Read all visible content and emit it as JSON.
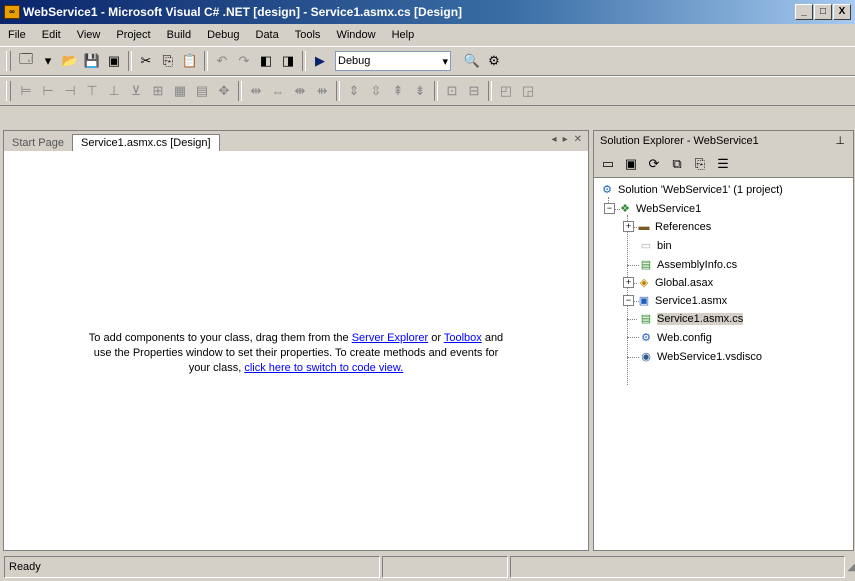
{
  "window": {
    "title": "WebService1 - Microsoft Visual C# .NET [design] - Service1.asmx.cs [Design]",
    "minimize": "_",
    "maximize": "□",
    "close": "X"
  },
  "menus": [
    "File",
    "Edit",
    "View",
    "Project",
    "Build",
    "Debug",
    "Data",
    "Tools",
    "Window",
    "Help"
  ],
  "toolbar": {
    "configuration": "Debug"
  },
  "document": {
    "tabs": [
      "Start Page",
      "Service1.asmx.cs [Design]"
    ],
    "message_line1_pre": "To add components to your class, drag them from the ",
    "server_explorer_link": "Server Explorer",
    "message_or": " or ",
    "toolbox_link": "Toolbox",
    "message_line1_post": " and",
    "message_line2": "use the Properties window to set their properties. To create methods and events for",
    "message_line3_pre": "your class, ",
    "code_view_link": "click here to switch to code view."
  },
  "solution_explorer": {
    "title": "Solution Explorer - WebService1",
    "tree": [
      {
        "label": "Solution 'WebService1' (1 project)",
        "icon": "solution-icon"
      },
      {
        "label": "WebService1",
        "icon": "project-icon"
      },
      {
        "label": "References",
        "icon": "references-icon"
      },
      {
        "label": "bin",
        "icon": "folder-icon"
      },
      {
        "label": "AssemblyInfo.cs",
        "icon": "cs-file-icon"
      },
      {
        "label": "Global.asax",
        "icon": "global-asax-icon"
      },
      {
        "label": "Service1.asmx",
        "icon": "asmx-icon"
      },
      {
        "label": "Service1.asmx.cs",
        "icon": "cs-file-icon"
      },
      {
        "label": "Web.config",
        "icon": "config-icon"
      },
      {
        "label": "WebService1.vsdisco",
        "icon": "disco-icon"
      }
    ]
  },
  "statusbar": {
    "text": "Ready"
  }
}
